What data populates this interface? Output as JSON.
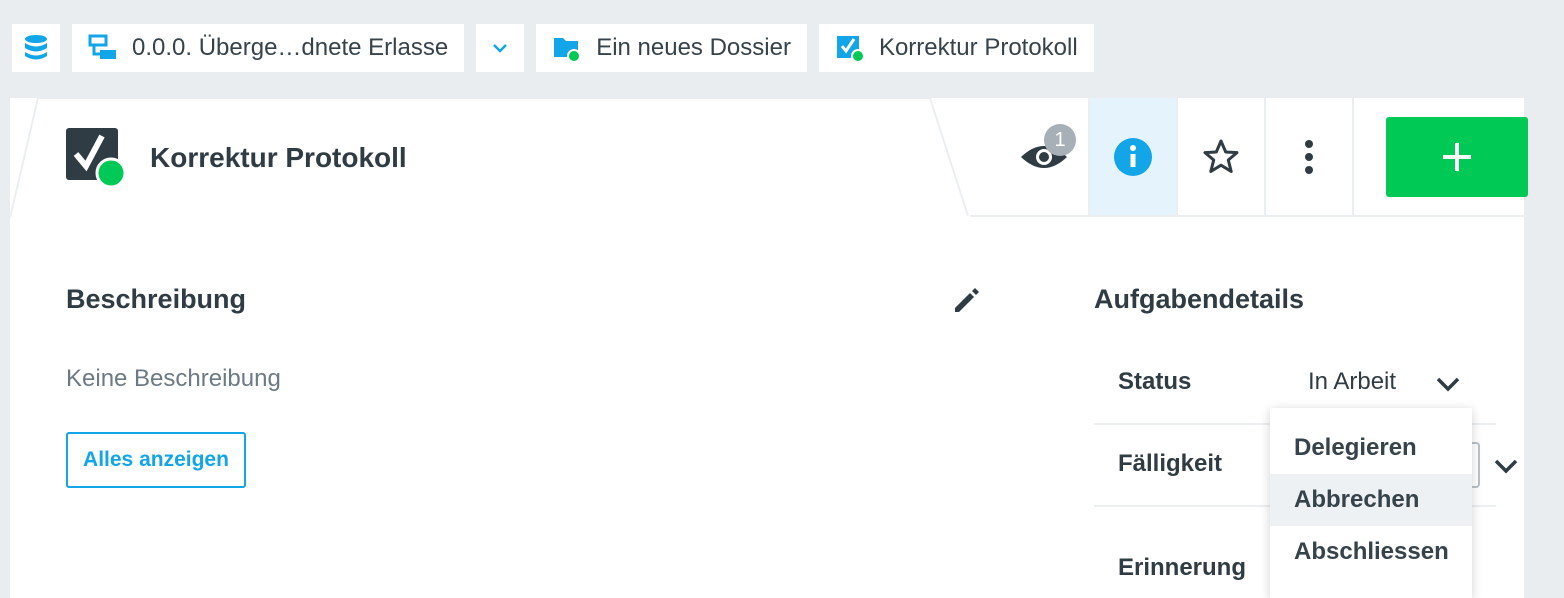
{
  "breadcrumbs": [
    {
      "label": ""
    },
    {
      "label": "0.0.0. Überge…dnete Erlasse"
    },
    {
      "label": ""
    },
    {
      "label": "Ein neues Dossier"
    },
    {
      "label": "Korrektur Protokoll"
    }
  ],
  "header": {
    "title": "Korrektur Protokoll",
    "watch_count": "1"
  },
  "description": {
    "heading": "Beschreibung",
    "empty_text": "Keine Beschreibung",
    "show_all_label": "Alles anzeigen"
  },
  "details": {
    "heading": "Aufgabendetails",
    "status_label": "Status",
    "status_value": "In Arbeit",
    "due_label": "Fälligkeit",
    "reminder_label": "Erinnerung"
  },
  "status_menu": {
    "items": [
      "Delegieren",
      "Abbrechen",
      "Abschliessen"
    ]
  },
  "colors": {
    "accent_blue": "#12a5e8",
    "add_green": "#00c955",
    "status_dot_green": "#00c955",
    "text_dark": "#2f3c44"
  }
}
